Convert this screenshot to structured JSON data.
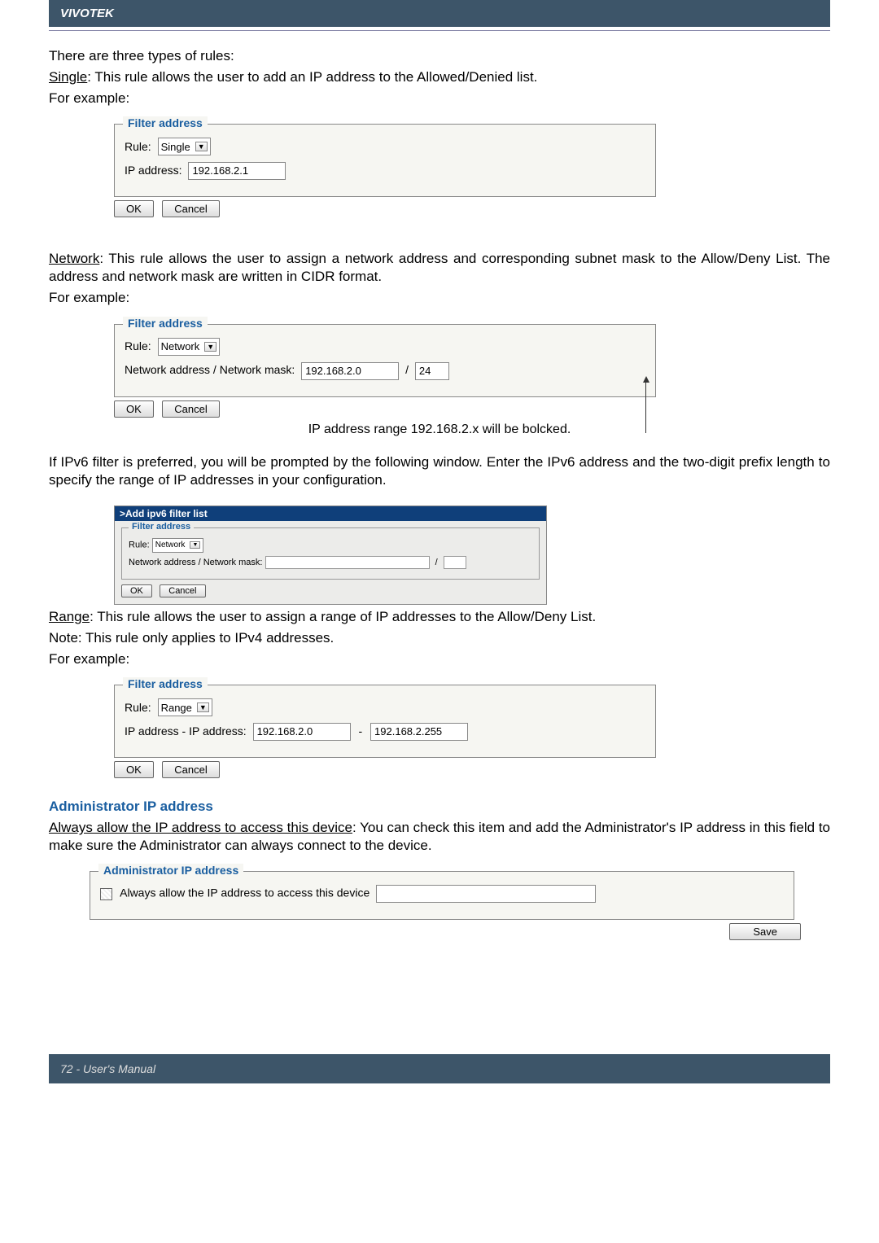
{
  "brand": "VIVOTEK",
  "intro": {
    "line1": "There are three types of rules:",
    "single_label": "Single",
    "single_rest": ": This rule allows the user to add an IP address to the Allowed/Denied list.",
    "for_example": "For example:"
  },
  "single_form": {
    "legend": "Filter address",
    "rule_label": "Rule:",
    "rule_value": "Single",
    "ip_label": "IP address:",
    "ip_value": "192.168.2.1",
    "ok": "OK",
    "cancel": "Cancel"
  },
  "network_para": {
    "label": "Network",
    "rest": ": This rule allows the user to assign a network address and corresponding subnet mask to the Allow/Deny List. The address and network mask are written in CIDR format.",
    "for_example": "For example:"
  },
  "network_form": {
    "legend": "Filter address",
    "rule_label": "Rule:",
    "rule_value": "Network",
    "mask_label": "Network address / Network mask:",
    "addr_value": "192.168.2.0",
    "mask_value": "24",
    "ok": "OK",
    "cancel": "Cancel",
    "annotation": "IP address range 192.168.2.x will be bolcked."
  },
  "ipv6_para": "If IPv6 filter is preferred, you will be prompted by the following window. Enter the IPv6 address and the two-digit prefix length to specify the range of IP addresses in your configuration.",
  "ipv6_form": {
    "title": ">Add ipv6 filter list",
    "legend": "Filter address",
    "rule_label": "Rule:",
    "rule_value": "Network",
    "mask_label": "Network address / Network mask:",
    "ok": "OK",
    "cancel": "Cancel"
  },
  "range_para": {
    "label": "Range",
    "rest": ": This rule allows the user to assign a range of IP addresses to the Allow/Deny List.",
    "note": "Note: This rule only applies to IPv4 addresses.",
    "for_example": "For example:"
  },
  "range_form": {
    "legend": "Filter address",
    "rule_label": "Rule:",
    "rule_value": "Range",
    "ip_label": "IP address - IP address:",
    "from": "192.168.2.0",
    "to": "192.168.2.255",
    "ok": "OK",
    "cancel": "Cancel"
  },
  "admin": {
    "heading": "Administrator IP address",
    "para_label": "Always allow the IP address to access this device",
    "para_rest": ": You can check this item and add the Administrator's IP address in this field to make sure the Administrator can always connect to the device.",
    "legend": "Administrator IP address",
    "checkbox_label": "Always allow the IP address to access this device",
    "save": "Save"
  },
  "footer": "72 - User's Manual"
}
